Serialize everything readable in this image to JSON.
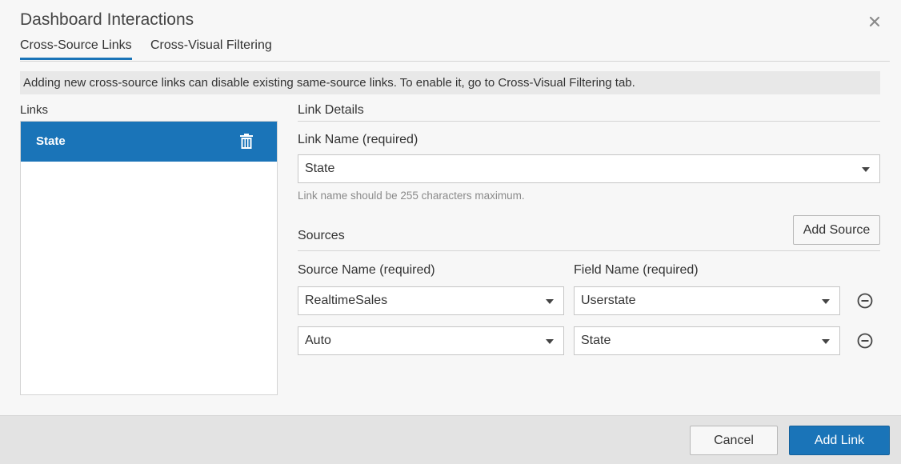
{
  "dialog": {
    "title": "Dashboard Interactions",
    "close_icon": "close-icon"
  },
  "tabs": [
    {
      "label": "Cross-Source Links",
      "active": true
    },
    {
      "label": "Cross-Visual Filtering",
      "active": false
    }
  ],
  "notice": "Adding new cross-source links can disable existing same-source links. To enable it, go to Cross-Visual Filtering tab.",
  "links": {
    "label": "Links",
    "items": [
      {
        "label": "State",
        "selected": true,
        "icon": "trash-icon"
      }
    ]
  },
  "details": {
    "title": "Link Details",
    "link_name_label": "Link Name (required)",
    "link_name_value": "State",
    "hint": "Link name should be 255 characters maximum.",
    "sources_label": "Sources",
    "add_source_label": "Add Source",
    "source_name_label": "Source Name (required)",
    "field_name_label": "Field Name (required)",
    "rows": [
      {
        "source": "RealtimeSales",
        "field": "Userstate"
      },
      {
        "source": "Auto",
        "field": "State"
      }
    ]
  },
  "footer": {
    "cancel_label": "Cancel",
    "add_link_label": "Add Link"
  },
  "colors": {
    "accent": "#1a74b8",
    "background": "#f7f7f7",
    "footer": "#e3e3e3"
  }
}
